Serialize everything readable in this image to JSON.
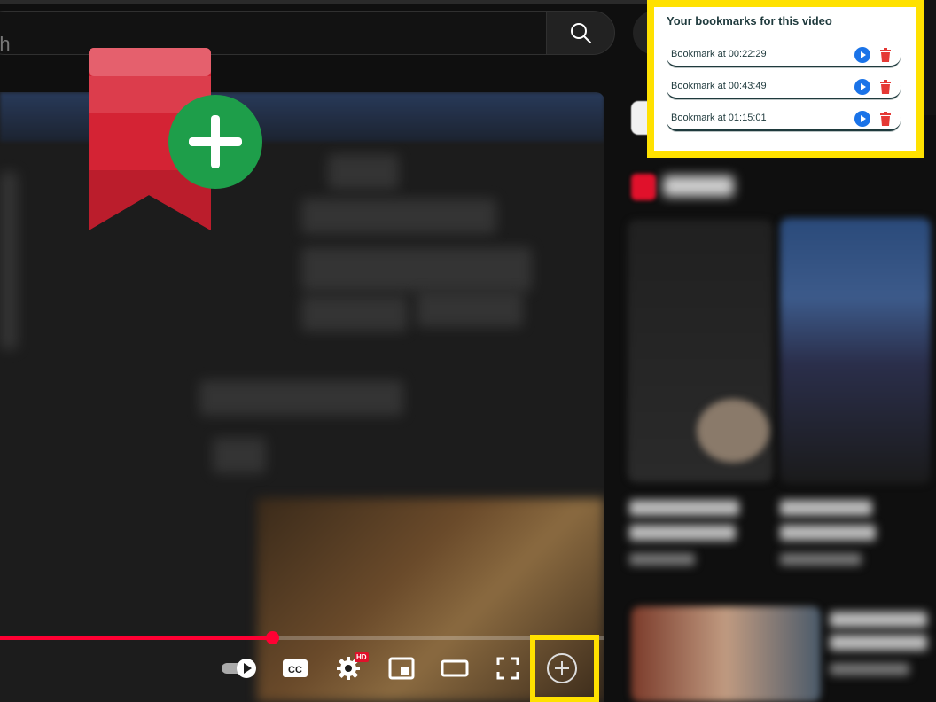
{
  "search": {
    "placeholder": "rch"
  },
  "popup": {
    "title": "Your bookmarks for this video",
    "bookmarks": [
      {
        "label": "Bookmark at 00:22:29"
      },
      {
        "label": "Bookmark at 00:43:49"
      },
      {
        "label": "Bookmark at 01:15:01"
      }
    ]
  },
  "player": {
    "progress_fraction": 0.45,
    "hd_badge": "HD"
  },
  "colors": {
    "highlight": "#ffe100",
    "progress": "#ff0033",
    "bookmark_red": "#d42334",
    "add_green": "#1e9e4a",
    "play_blue": "#1a73e8",
    "delete_red": "#e53935",
    "popup_text": "#1f3a3d"
  },
  "icons": {
    "search": "search-icon",
    "logo": "bookmark-add-logo",
    "autoplay": "autoplay-toggle-icon",
    "captions": "captions-icon",
    "settings": "settings-gear-icon",
    "miniplayer": "miniplayer-icon",
    "theater": "theater-mode-icon",
    "fullscreen": "fullscreen-icon",
    "add_bookmark": "add-bookmark-icon",
    "play": "play-icon",
    "delete": "delete-icon"
  }
}
